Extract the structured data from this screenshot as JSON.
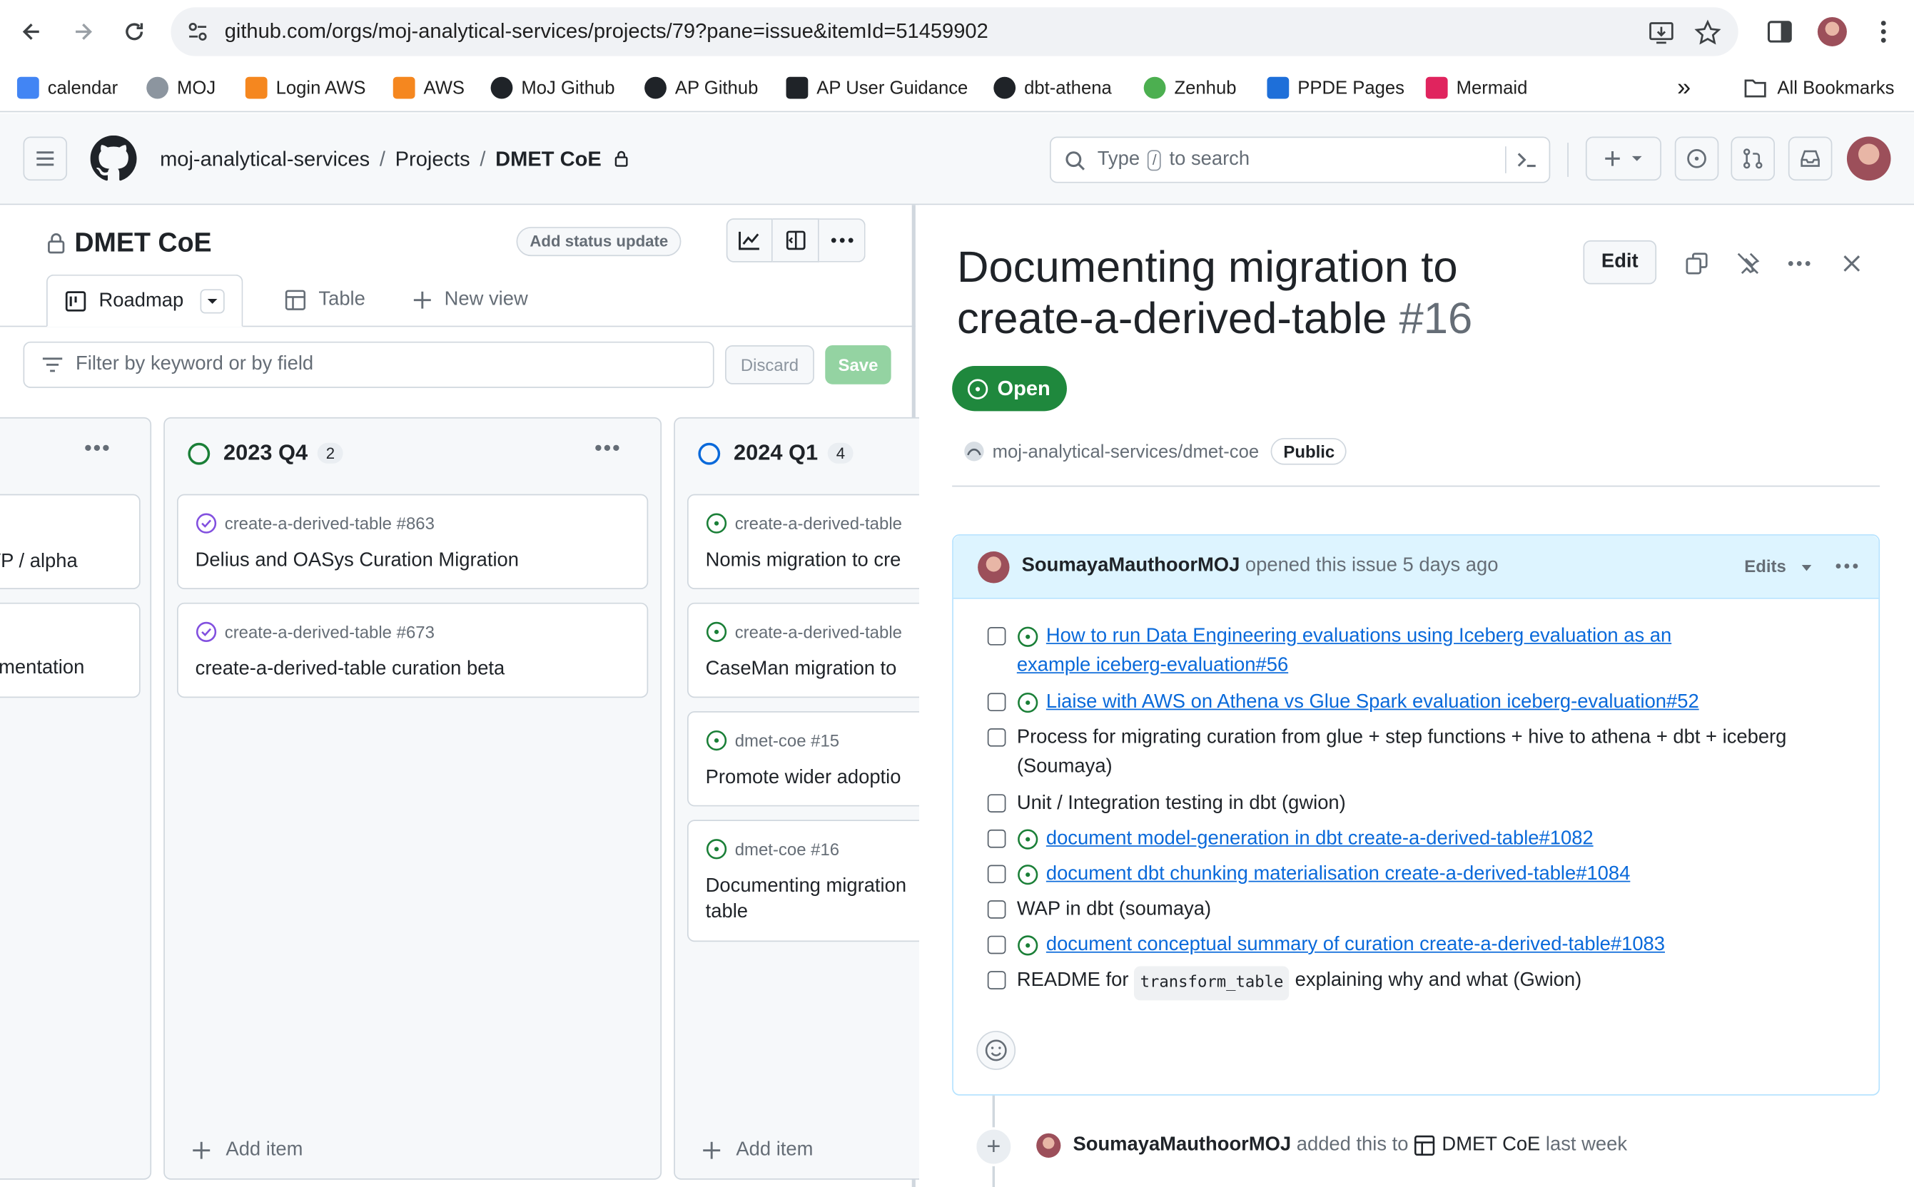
{
  "browser": {
    "url": "github.com/orgs/moj-analytical-services/projects/79?pane=issue&itemId=51459902",
    "bookmarks": [
      {
        "label": "calendar",
        "color": "#4285f4"
      },
      {
        "label": "MOJ",
        "color": "#6e7781"
      },
      {
        "label": "Login AWS",
        "color": "#f5871f"
      },
      {
        "label": "AWS",
        "color": "#f5871f"
      },
      {
        "label": "MoJ Github",
        "color": "#1f2328"
      },
      {
        "label": "AP Github",
        "color": "#1f2328"
      },
      {
        "label": "AP User Guidance",
        "color": "#1f2328"
      },
      {
        "label": "dbt-athena",
        "color": "#1f2328"
      },
      {
        "label": "Zenhub",
        "color": "#4caf50"
      },
      {
        "label": "PPDE Pages",
        "color": "#1e6fd9"
      },
      {
        "label": "Mermaid",
        "color": "#e0245e"
      }
    ],
    "more_label": "»",
    "all_bookmarks": "All Bookmarks"
  },
  "header": {
    "org": "moj-analytical-services",
    "projects": "Projects",
    "project": "DMET CoE",
    "search_before": "Type",
    "search_key": "/",
    "search_after": "to search"
  },
  "project": {
    "title": "DMET CoE",
    "status_update": "Add status update",
    "tabs": [
      {
        "label": "Roadmap"
      },
      {
        "label": "Table"
      },
      {
        "label": "New view"
      }
    ],
    "filter_placeholder": "Filter by keyword or by field",
    "discard": "Discard",
    "save": "Save",
    "columns": [
      {
        "name": "",
        "cards": [
          {
            "meta": "",
            "title": "VP / alpha"
          },
          {
            "meta": "",
            "title": "umentation"
          }
        ]
      },
      {
        "name": "2023 Q4",
        "count": "2",
        "status_color": "#1a7f37",
        "cards": [
          {
            "meta": "create-a-derived-table #863",
            "title": "Delius and OASys Curation Migration",
            "state": "closed"
          },
          {
            "meta": "create-a-derived-table #673",
            "title": "create-a-derived-table curation beta",
            "state": "closed"
          }
        ],
        "add_item": "Add item"
      },
      {
        "name": "2024 Q1",
        "count": "4",
        "status_color": "#0969da",
        "cards": [
          {
            "meta": "create-a-derived-table",
            "title": "Nomis migration to cre",
            "state": "open"
          },
          {
            "meta": "create-a-derived-table",
            "title": "CaseMan migration to",
            "state": "open"
          },
          {
            "meta": "dmet-coe #15",
            "title": "Promote wider adoptio",
            "state": "open"
          },
          {
            "meta": "dmet-coe #16",
            "title": "Documenting migration",
            "title2": "table",
            "state": "open"
          }
        ],
        "add_item": "Add item"
      }
    ]
  },
  "issue": {
    "title": "Documenting migration to create-a-derived-table",
    "number": "#16",
    "edit": "Edit",
    "state": "Open",
    "repo": "moj-analytical-services/dmet-coe",
    "visibility": "Public",
    "author": "SoumayaMauthoorMOJ",
    "opened": "opened this issue 5 days ago",
    "edits": "Edits",
    "tasks": [
      {
        "linked": true,
        "text": "How to run Data Engineering evaluations using Iceberg evaluation as an",
        "text2": "example iceberg-evaluation#56"
      },
      {
        "linked": true,
        "text": "Liaise with AWS on Athena vs Glue Spark evaluation iceberg-evaluation#52"
      },
      {
        "linked": false,
        "text": "Process for migrating curation from glue + step functions + hive to athena + dbt + iceberg",
        "text2": "(Soumaya)"
      },
      {
        "linked": false,
        "text": "Unit / Integration testing in dbt (gwion)"
      },
      {
        "linked": true,
        "text": "document model-generation in dbt create-a-derived-table#1082"
      },
      {
        "linked": true,
        "text": "document dbt chunking materialisation create-a-derived-table#1084"
      },
      {
        "linked": false,
        "text": "WAP in dbt (soumaya)"
      },
      {
        "linked": true,
        "text": "document conceptual summary of curation create-a-derived-table#1083"
      },
      {
        "linked": false,
        "text": "README for",
        "code": "transform_table",
        "text3": "explaining why and what (Gwion)"
      }
    ],
    "timeline": {
      "author": "SoumayaMauthoorMOJ",
      "action": "added this to",
      "project": "DMET CoE",
      "when": "last week"
    }
  }
}
